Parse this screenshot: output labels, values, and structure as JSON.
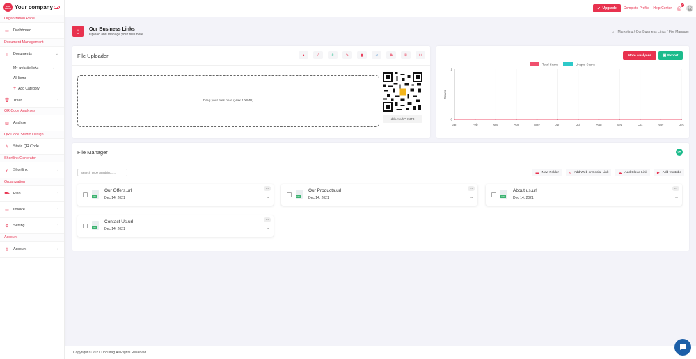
{
  "brand": {
    "logo_text": "DOC DRAG",
    "name": "Your company"
  },
  "sidebar": {
    "sec_org_panel": "Organization Panel",
    "dashboard": "Dashboard",
    "sec_doc_mgmt": "Document Management",
    "documents": "Documents",
    "my_website_links": "My website links",
    "all_items": "All Items",
    "add_category": "Add Category",
    "trash": "Trash",
    "sec_qr_analyses": "QR Code Analyses",
    "analyse": "Analyse",
    "sec_qr_design": "QR Code Studio Design",
    "static_qr": "Static QR Code",
    "sec_shortlink": "Shortlink Generator",
    "shortlink": "Shortlink",
    "sec_organization": "Organization",
    "plan": "Plan",
    "invoice": "Invoice",
    "setting": "Setting",
    "sec_account": "Account",
    "account": "Account"
  },
  "topbar": {
    "upgrade": "Upgrade",
    "complete_profile": "Complete Profile",
    "sep": "·",
    "help": "Help Center",
    "notif_count": "0"
  },
  "page": {
    "title": "Our Business Links",
    "subtitle": "Upload and manage your files here",
    "breadcrumb": "Marketing / Our Business Links / File Manager"
  },
  "uploader": {
    "title": "File Uploader",
    "drop_text": "Drag your files here (Max 100MB)",
    "short_link": "dds.me/hPH5tT3"
  },
  "chart_card": {
    "more_analyses": "More Analyses",
    "export": "Export"
  },
  "chart_data": {
    "type": "line",
    "categories": [
      "Jan",
      "Feb",
      "Mar",
      "Apr",
      "May",
      "Jun",
      "Jul",
      "Aug",
      "Sep",
      "Oct",
      "Nov",
      "Dec"
    ],
    "series": [
      {
        "name": "Total Scans",
        "color": "#f0506e",
        "values": [
          0,
          0,
          0,
          0,
          0,
          0,
          0,
          0,
          0,
          0,
          0,
          0
        ]
      },
      {
        "name": "Unique Scans",
        "color": "#2ec9c9",
        "values": [
          0,
          0,
          0,
          0,
          0,
          0,
          0,
          0,
          0,
          0,
          0,
          0
        ]
      }
    ],
    "ylabel": "Scans",
    "ylim": [
      0,
      1
    ],
    "yticks": [
      "0",
      "1"
    ],
    "grid": true,
    "legend": "top-center"
  },
  "file_manager": {
    "title": "File Manager",
    "search_placeholder": "Search Type Anything.....",
    "actions": [
      "New Folder",
      "Add Web or Social Link",
      "Add Cloud Link",
      "Add Youtube"
    ],
    "files": [
      {
        "name": "Our Offers.url",
        "date": "Dec 14, 2021"
      },
      {
        "name": "Our Products.url",
        "date": "Dec 14, 2021"
      },
      {
        "name": "About us.url",
        "date": "Dec 14, 2021"
      },
      {
        "name": "Contact Us.url",
        "date": "Dec 14, 2021"
      }
    ]
  },
  "footer": {
    "text": "Copyright © 2021 DocDrag All Rights Reserved."
  },
  "colors": {
    "accent": "#e8324f",
    "green": "#1cbb8c",
    "chat": "#1c5fa8"
  }
}
